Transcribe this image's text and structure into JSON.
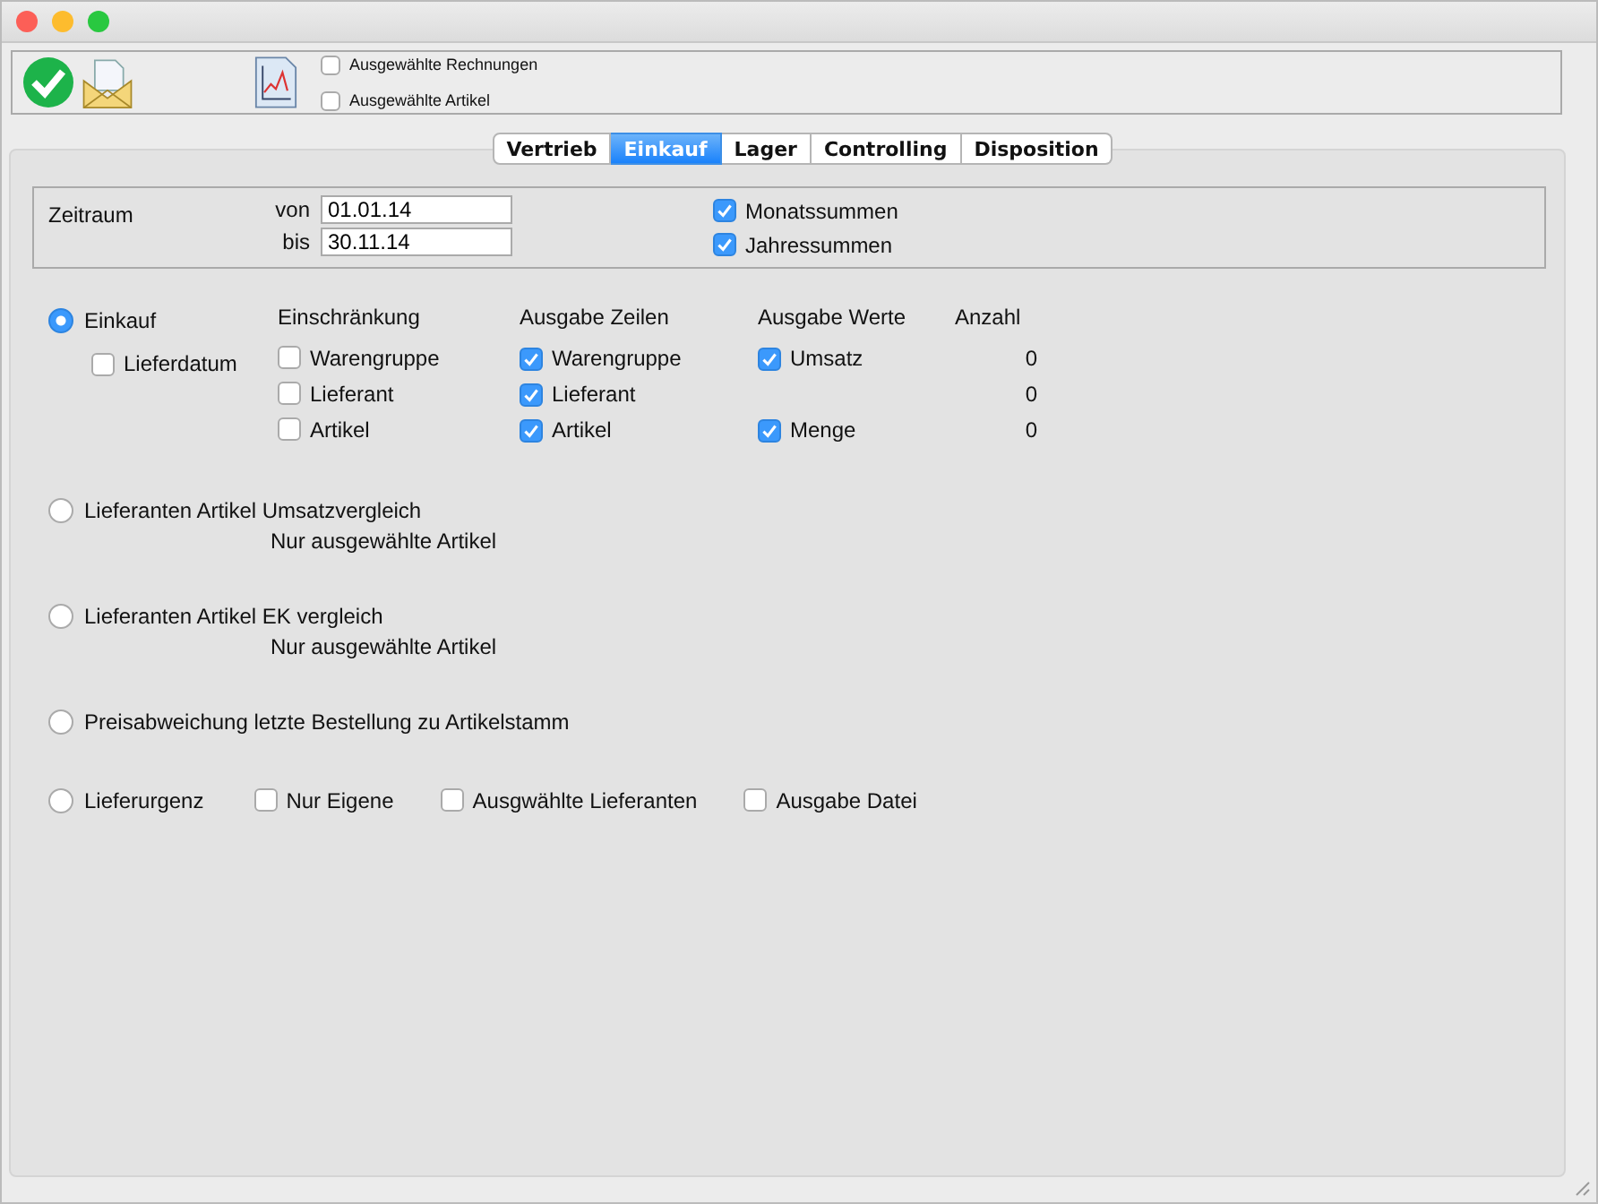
{
  "toolbar": {
    "checkboxes": [
      {
        "label": "Ausgewählte Rechnungen",
        "checked": false
      },
      {
        "label": "Ausgewählte Artikel",
        "checked": false
      }
    ]
  },
  "tabs": [
    {
      "label": "Vertrieb",
      "selected": false
    },
    {
      "label": "Einkauf",
      "selected": true
    },
    {
      "label": "Lager",
      "selected": false
    },
    {
      "label": "Controlling",
      "selected": false
    },
    {
      "label": "Disposition",
      "selected": false
    }
  ],
  "zeitraum": {
    "label": "Zeitraum",
    "from_label": "von",
    "from_value": "01.01.14",
    "to_label": "bis",
    "to_value": "30.11.14",
    "checkboxes": [
      {
        "label": "Monatssummen",
        "checked": true
      },
      {
        "label": "Jahressummen",
        "checked": true
      }
    ]
  },
  "einkauf": {
    "label": "Einkauf",
    "selected": true,
    "lieferdatum": {
      "label": "Lieferdatum",
      "checked": false
    },
    "headers": [
      "Einschränkung",
      "Ausgabe Zeilen",
      "Ausgabe Werte",
      "Anzahl"
    ],
    "rows": [
      {
        "restriction": {
          "label": "Warengruppe",
          "checked": false
        },
        "line": {
          "label": "Warengruppe",
          "checked": true
        },
        "value": {
          "label": "Umsatz",
          "checked": true
        },
        "count": "0"
      },
      {
        "restriction": {
          "label": "Lieferant",
          "checked": false
        },
        "line": {
          "label": "Lieferant",
          "checked": true
        },
        "count": "0"
      },
      {
        "restriction": {
          "label": "Artikel",
          "checked": false
        },
        "line": {
          "label": "Artikel",
          "checked": true
        },
        "value": {
          "label": "Menge",
          "checked": true
        },
        "count": "0"
      }
    ]
  },
  "options": [
    {
      "label": "Lieferanten Artikel Umsatzvergleich",
      "selected": false,
      "note": "Nur ausgewählte Artikel"
    },
    {
      "label": "Lieferanten Artikel EK vergleich",
      "selected": false,
      "note": "Nur ausgewählte Artikel"
    },
    {
      "label": "Preisabweichung letzte Bestellung zu Artikelstamm",
      "selected": false
    },
    {
      "label": "Lieferurgenz",
      "selected": false,
      "checkboxes": [
        {
          "label": "Nur Eigene",
          "checked": false
        },
        {
          "label": "Ausgwählte Lieferanten",
          "checked": false
        },
        {
          "label": "Ausgabe Datei",
          "checked": false
        }
      ]
    }
  ]
}
